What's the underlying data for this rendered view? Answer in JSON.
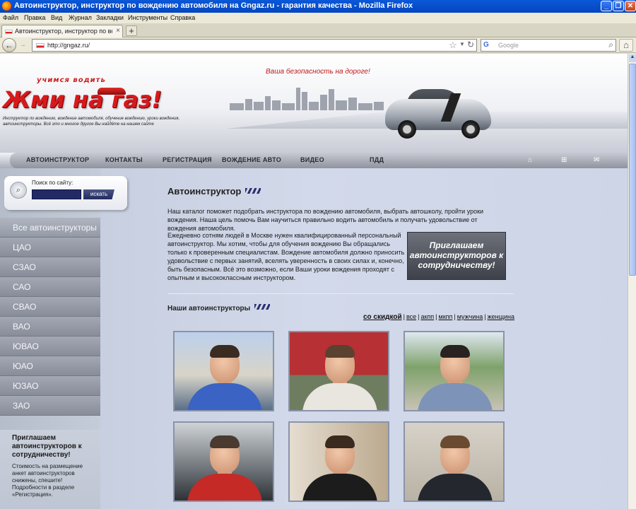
{
  "browser": {
    "window_title": "Автоинструктор, инструктор по вождению автомобиля на Gngaz.ru - гарантия качества - Mozilla Firefox",
    "menu": [
      "Файл",
      "Правка",
      "Вид",
      "Журнал",
      "Закладки",
      "Инструменты",
      "Справка"
    ],
    "tab_title": "Автоинструктор, инструктор по вождени...",
    "url": "http://gngaz.ru/",
    "search_placeholder": "Google",
    "search_engine_glyph": "G"
  },
  "header": {
    "logo_small": "учимся водить",
    "logo": "Жми на газ!",
    "tagline": "Инструктор по вождению, вождение автомобиля, обучение вождению, уроки вождения, автоинструкторы. Всё это и многое другое Вы найдёте на нашем сайте",
    "slogan": "Ваша безопасность на дороге!"
  },
  "nav": {
    "items": [
      "АВТОИНСТРУКТОР",
      "КОНТАКТЫ",
      "РЕГИСТРАЦИЯ",
      "ВОЖДЕНИЕ АВТО",
      "ВИДЕО",
      "ПДД"
    ],
    "icons": [
      "home-icon",
      "sitemap-icon",
      "mail-icon"
    ]
  },
  "sidebar": {
    "search_label": "Поиск по сайту:",
    "search_value": "",
    "search_button": "искать",
    "districts": [
      "Все автоинструкторы",
      "ЦАО",
      "СЗАО",
      "САО",
      "СВАО",
      "ВАО",
      "ЮВАО",
      "ЮАО",
      "ЮЗАО",
      "ЗАО"
    ],
    "promo_title": "Приглашаем автоинструкторов к сотрудничеству!",
    "promo_text": "Стоимость на размещение анкет автоинструкторов снижены, спешите! Подробности в разделе «Регистрация»."
  },
  "main": {
    "title": "Автоинструктор",
    "intro": "Наш каталог поможет подобрать инструктора по вождению автомобиля, выбрать автошколу, пройти уроки вождения. Наша цель помочь Вам научиться правильно водить автомобиль и получать удовольствие от вождения автомобиля.",
    "body": "Ежедневно сотням людей в Москве нужен квалифицированный персональный автоинструктор. Мы хотим, чтобы для обучения вождению Вы обращались только к проверенным специалистам. Вождение автомобиля должно приносить удовольствие с первых занятий, вселять уверенность в своих силах и, конечно, быть безопасным. Всё это возможно, если Ваши уроки вождения проходят с опытным и высококлассным инструктором.",
    "banner": "Приглашаем автоинструкторов к сотрудничеству!",
    "section_title": "Наши автоинструкторы",
    "filters": [
      "со скидкой",
      "все",
      "акпп",
      "мкпп",
      "мужчина",
      "женщина"
    ]
  },
  "colors": {
    "accent_red": "#d8191c",
    "nav_dark": "#232b5e",
    "sidebar_grey": "#878d99"
  }
}
